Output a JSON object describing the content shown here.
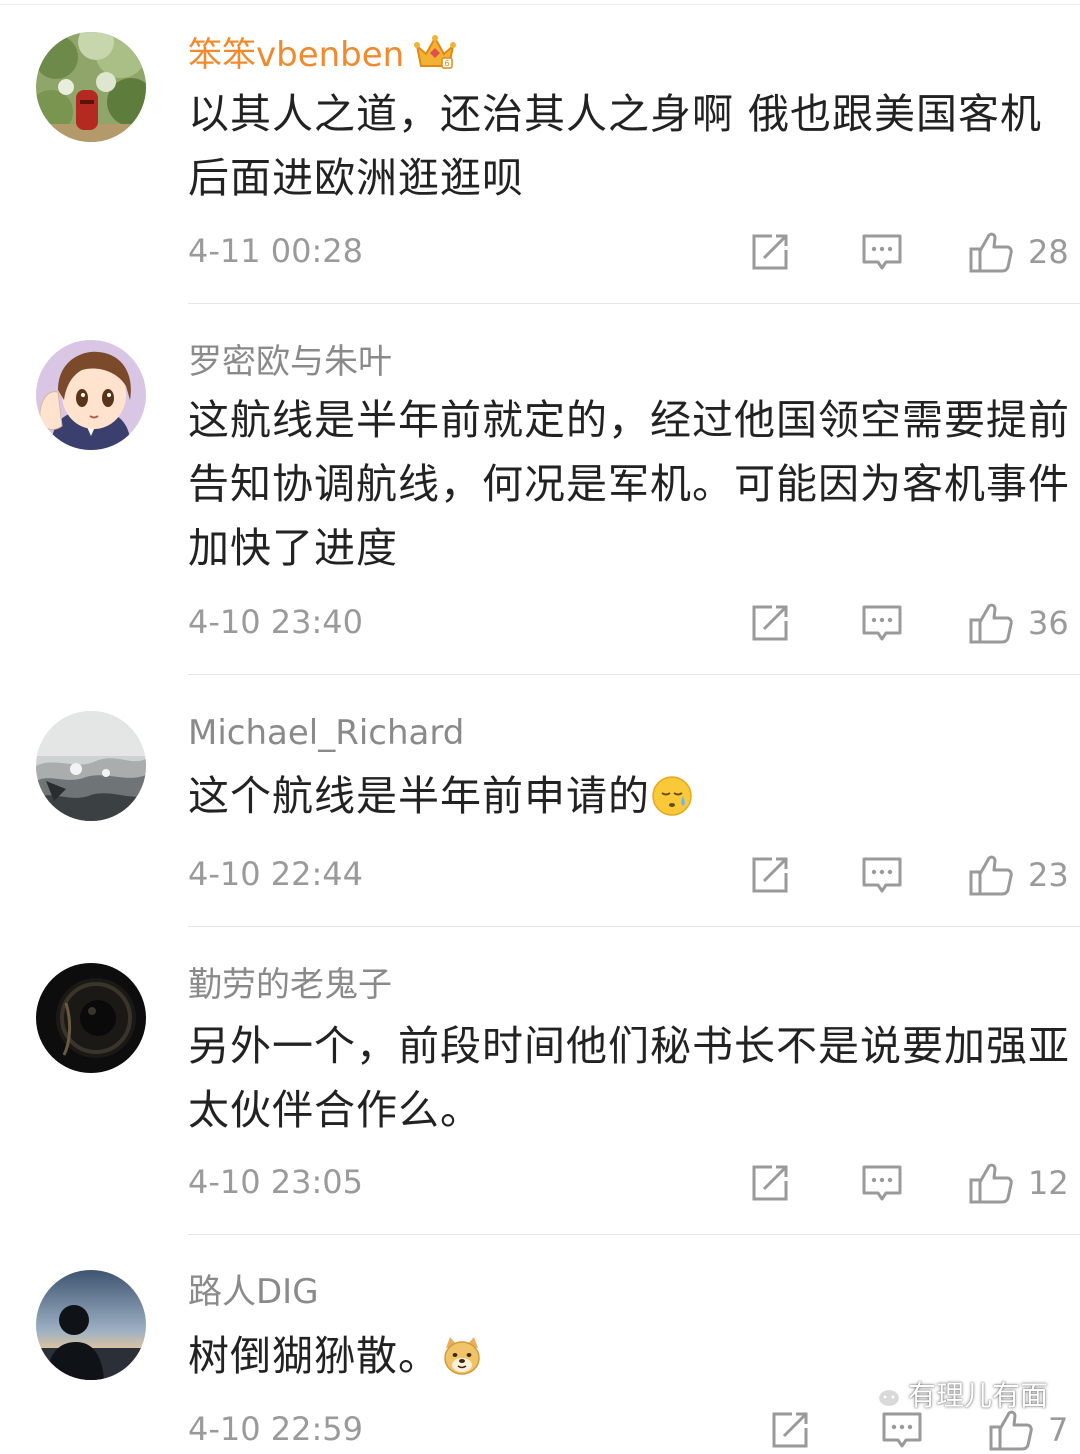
{
  "comments": [
    {
      "username": "笨笨vbenben",
      "text": "以其人之道，还治其人之身啊  俄也跟美国客机后面进欧洲逛逛呗",
      "time": "4-11 00:28",
      "likes": "28",
      "avatar": "garden-mailbox-avatar",
      "username_color": "#f08a2c",
      "badge": "crown-icon"
    },
    {
      "username": "罗密欧与朱叶",
      "text": "这航线是半年前就定的，经过他国领空需要提前告知协调航线，何况是军机。可能因为客机事件加快了进度",
      "time": "4-10 23:40",
      "likes": "36",
      "avatar": "anime-girl-avatar"
    },
    {
      "username": "Michael_Richard",
      "text": "这个航线是半年前申请的",
      "time": "4-10 22:44",
      "likes": "23",
      "avatar": "sea-waves-avatar",
      "emoji": "sweat-face-emoji"
    },
    {
      "username": "勤劳的老鬼子",
      "text": "另外一个，前段时间他们秘书长不是说要加强亚太伙伴合作么。",
      "time": "4-10 23:05",
      "likes": "12",
      "avatar": "dark-lens-avatar"
    },
    {
      "username": "路人DIG",
      "text": "树倒猢狲散。",
      "time": "4-10 22:59",
      "likes": "7",
      "avatar": "silhouette-sunset-avatar",
      "emoji": "doge-emoji"
    }
  ],
  "icons": {
    "share": "share-icon",
    "reply": "comment-icon",
    "like": "thumbs-up-icon"
  },
  "watermark": {
    "text": "有理儿有面",
    "icon": "wechat-icon"
  }
}
